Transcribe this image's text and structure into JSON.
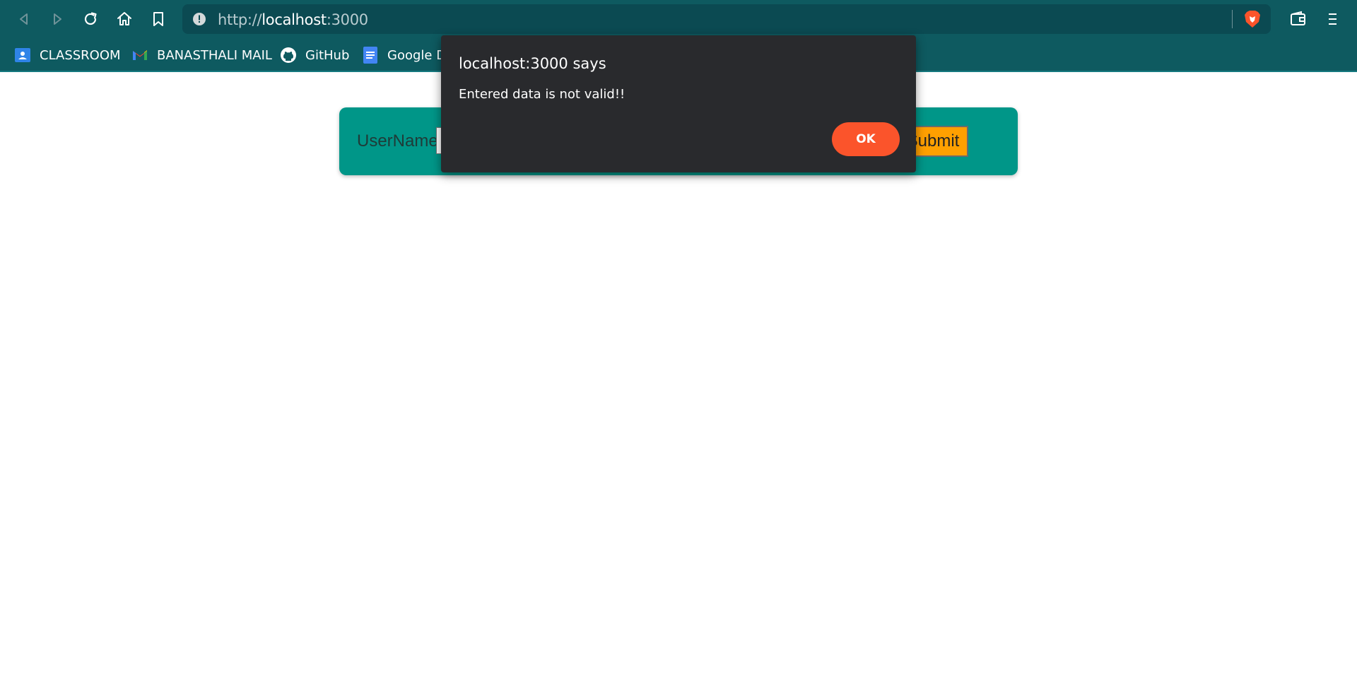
{
  "browser": {
    "url_scheme": "http://",
    "url_host": "localhost",
    "url_port": ":3000",
    "bookmarks": [
      {
        "label": "CLASSROOM",
        "icon": "classroom-icon"
      },
      {
        "label": "BANASTHALI MAIL",
        "icon": "gmail-icon"
      },
      {
        "label": "GitHub",
        "icon": "github-icon"
      },
      {
        "label": "Google D",
        "icon": "google-docs-icon"
      }
    ]
  },
  "form": {
    "username_label": "UserName",
    "username_value": "",
    "submit_label": "Submit"
  },
  "dialog": {
    "title": "localhost:3000 says",
    "message": "Entered data is not valid!!",
    "ok_label": "OK"
  },
  "colors": {
    "chrome": "#0e5a60",
    "form_card": "#009688",
    "submit": "#ffa000",
    "dialog_bg": "#292a2d",
    "ok_button": "#fb542b"
  }
}
